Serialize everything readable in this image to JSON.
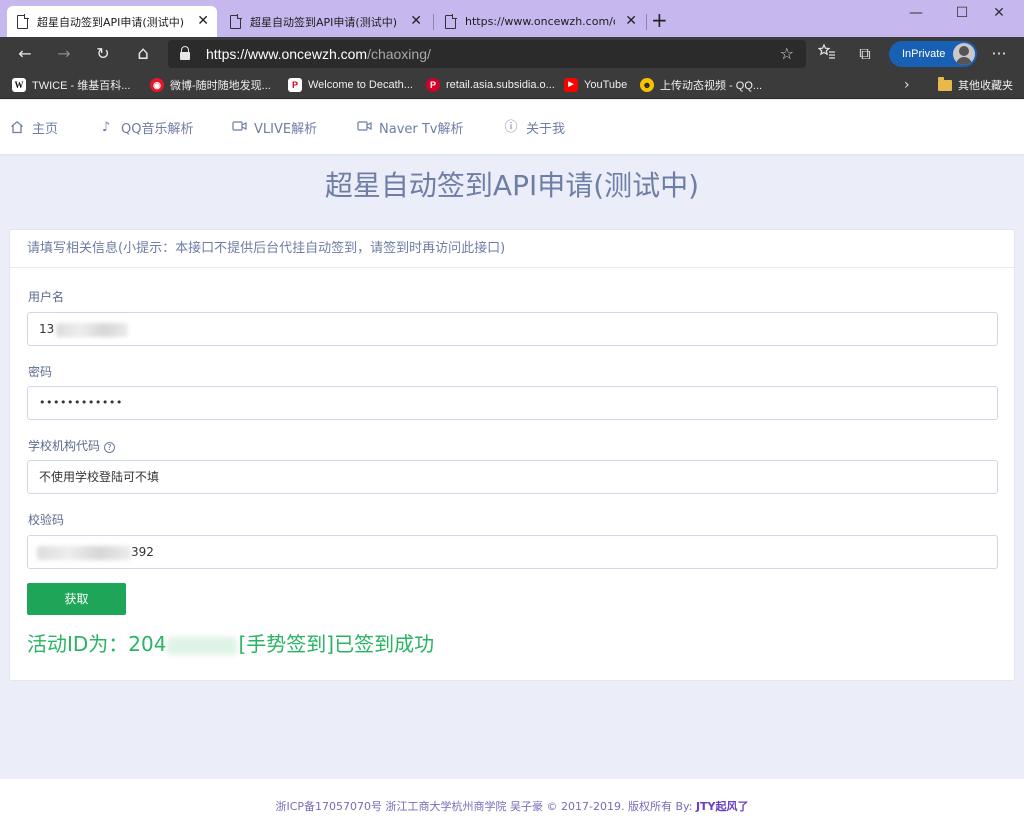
{
  "browser": {
    "tabs": [
      {
        "title": "超星自动签到API申请(测试中)",
        "active": true
      },
      {
        "title": "超星自动签到API申请(测试中)",
        "active": false
      },
      {
        "title": "https://www.oncewzh.com/chao",
        "active": false
      }
    ],
    "tab_close": "✕",
    "new_tab": "+",
    "window_controls": {
      "minimize": "—",
      "maximize": "☐",
      "close": "✕"
    },
    "toolbar": {
      "back": "←",
      "forward": "→",
      "refresh": "↻",
      "home": "⌂",
      "favorites": "☆",
      "collections": "⧉",
      "menu": "···"
    },
    "address": {
      "host": "https://www.oncewzh.com",
      "path": "/chaoxing/"
    },
    "inprivate_label": "InPrivate",
    "bookmarks": [
      {
        "label": "TWICE - 维基百科...",
        "icon": "W",
        "color": "#ffffff",
        "fg": "#111111"
      },
      {
        "label": "微博-随时随地发现...",
        "icon": "◉",
        "color": "#e6162d",
        "fg": "#ffffff"
      },
      {
        "label": "Welcome to Decath...",
        "icon": "P",
        "color": "#ffffff",
        "fg": "#d4002a"
      },
      {
        "label": "retail.asia.subsidia.o...",
        "icon": "P",
        "color": "#d4002a",
        "fg": "#ffffff"
      },
      {
        "label": "YouTube",
        "icon": "▶",
        "color": "#ff0000",
        "fg": "#ffffff"
      },
      {
        "label": "上传动态视频 - QQ...",
        "icon": "☻",
        "color": "#f5c400",
        "fg": "#1a1a1a"
      }
    ],
    "bookmarks_more": "›",
    "other_bookmarks": "其他收藏夹"
  },
  "nav": {
    "items": [
      {
        "label": "主页",
        "icon": "⌂"
      },
      {
        "label": "QQ音乐解析",
        "icon": "♪"
      },
      {
        "label": "VLIVE解析",
        "icon": "▭"
      },
      {
        "label": "Naver Tv解析",
        "icon": "▭"
      },
      {
        "label": "关于我",
        "icon": "ⓘ"
      }
    ]
  },
  "main": {
    "title": "超星自动签到API申请(测试中)",
    "card_header": "请填写相关信息(小提示：本接口不提供后台代挂自动签到，请签到时再访问此接口)",
    "fields": {
      "username_label": "用户名",
      "username_value": "13",
      "password_label": "密码",
      "password_value": "••••••••••••",
      "school_label": "学校机构代码",
      "school_help": "?",
      "school_value": "不使用学校登陆可不填",
      "captcha_label": "校验码",
      "captcha_value": "392"
    },
    "submit_label": "获取",
    "result_prefix": "活动ID为：204",
    "result_suffix": "[手势签到]已签到成功"
  },
  "footer": {
    "text": "浙ICP备17057070号 浙江工商大学杭州商学院 吴子豪 © 2017-2019. 版权所有 By: ",
    "author": "JTY起风了"
  }
}
